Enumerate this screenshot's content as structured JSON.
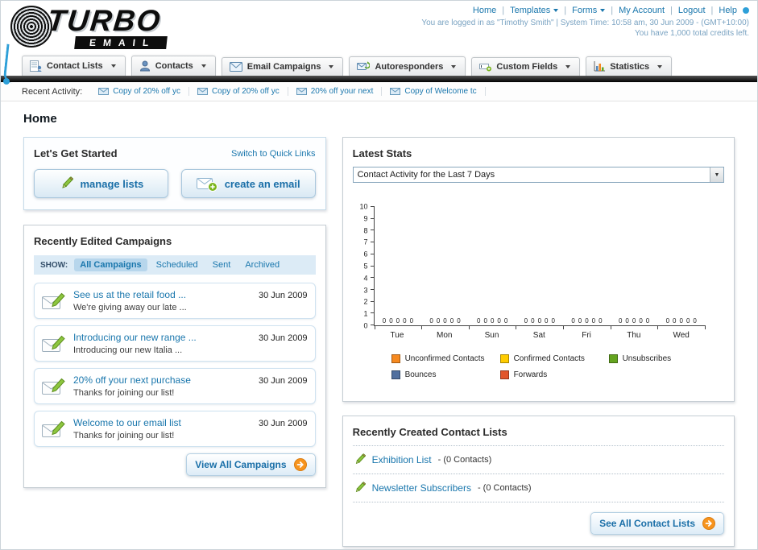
{
  "logo": {
    "title": "TURBO",
    "subtitle": "EMAIL"
  },
  "header": {
    "links": [
      "Home",
      "Templates",
      "Forms",
      "My Account",
      "Logout",
      "Help"
    ],
    "session": "You are logged in as \"Timothy Smith\" | System Time: 10:58 am, 30 Jun 2009 - (GMT+10:00)",
    "credits": "You have 1,000 total credits left."
  },
  "nav": {
    "items": [
      {
        "label": "Contact Lists"
      },
      {
        "label": "Contacts"
      },
      {
        "label": "Email Campaigns"
      },
      {
        "label": "Autoresponders"
      },
      {
        "label": "Custom Fields"
      },
      {
        "label": "Statistics"
      }
    ]
  },
  "activity": {
    "label": "Recent Activity:",
    "items": [
      {
        "label": "Copy of 20% off yc"
      },
      {
        "label": "Copy of 20% off yc"
      },
      {
        "label": "20% off your next"
      },
      {
        "label": "Copy of Welcome tc"
      }
    ]
  },
  "page": {
    "title": "Home"
  },
  "get_started": {
    "title": "Let's Get Started",
    "switch_link": "Switch to Quick Links",
    "manage_button": "manage lists",
    "create_button": "create an email"
  },
  "campaigns": {
    "title": "Recently Edited Campaigns",
    "show_label": "SHOW:",
    "tabs": [
      "All Campaigns",
      "Scheduled",
      "Sent",
      "Archived"
    ],
    "active_tab": "All Campaigns",
    "items": [
      {
        "title": "See us at the retail food ...",
        "subtitle": "We're giving away our late ...",
        "date": "30 Jun 2009"
      },
      {
        "title": "Introducing our new range ...",
        "subtitle": "Introducing our new Italia ...",
        "date": "30 Jun 2009"
      },
      {
        "title": "20% off your next purchase",
        "subtitle": "Thanks for joining our list!",
        "date": "30 Jun 2009"
      },
      {
        "title": "Welcome to our email list",
        "subtitle": "Thanks for joining our list!",
        "date": "30 Jun 2009"
      }
    ],
    "view_all": "View All Campaigns"
  },
  "stats": {
    "title": "Latest Stats",
    "dropdown_value": "Contact Activity for the Last 7 Days",
    "chart_data": {
      "type": "bar",
      "title": "Contact Activity for the Last 7 Days",
      "categories": [
        "Tue",
        "Mon",
        "Sun",
        "Sat",
        "Fri",
        "Thu",
        "Wed"
      ],
      "series": [
        {
          "name": "Unconfirmed Contacts",
          "color": "#F6891F",
          "values": [
            0,
            0,
            0,
            0,
            0,
            0,
            0
          ]
        },
        {
          "name": "Confirmed Contacts",
          "color": "#FFCC00",
          "values": [
            0,
            0,
            0,
            0,
            0,
            0,
            0
          ]
        },
        {
          "name": "Unsubscribes",
          "color": "#64A41F",
          "values": [
            0,
            0,
            0,
            0,
            0,
            0,
            0
          ]
        },
        {
          "name": "Bounces",
          "color": "#51709F",
          "values": [
            0,
            0,
            0,
            0,
            0,
            0,
            0
          ]
        },
        {
          "name": "Forwards",
          "color": "#E2552B",
          "values": [
            0,
            0,
            0,
            0,
            0,
            0,
            0
          ]
        }
      ],
      "ylim": [
        0,
        10
      ],
      "yticks": [
        0,
        1,
        2,
        3,
        4,
        5,
        6,
        7,
        8,
        9,
        10
      ],
      "grid": false,
      "legend_position": "bottom",
      "value_labels": true
    }
  },
  "contact_lists": {
    "title": "Recently Created Contact Lists",
    "items": [
      {
        "name": "Exhibition List",
        "suffix": "- (0 Contacts)"
      },
      {
        "name": "Newsletter Subscribers",
        "suffix": "- (0 Contacts)"
      }
    ],
    "see_all": "See All Contact Lists"
  }
}
